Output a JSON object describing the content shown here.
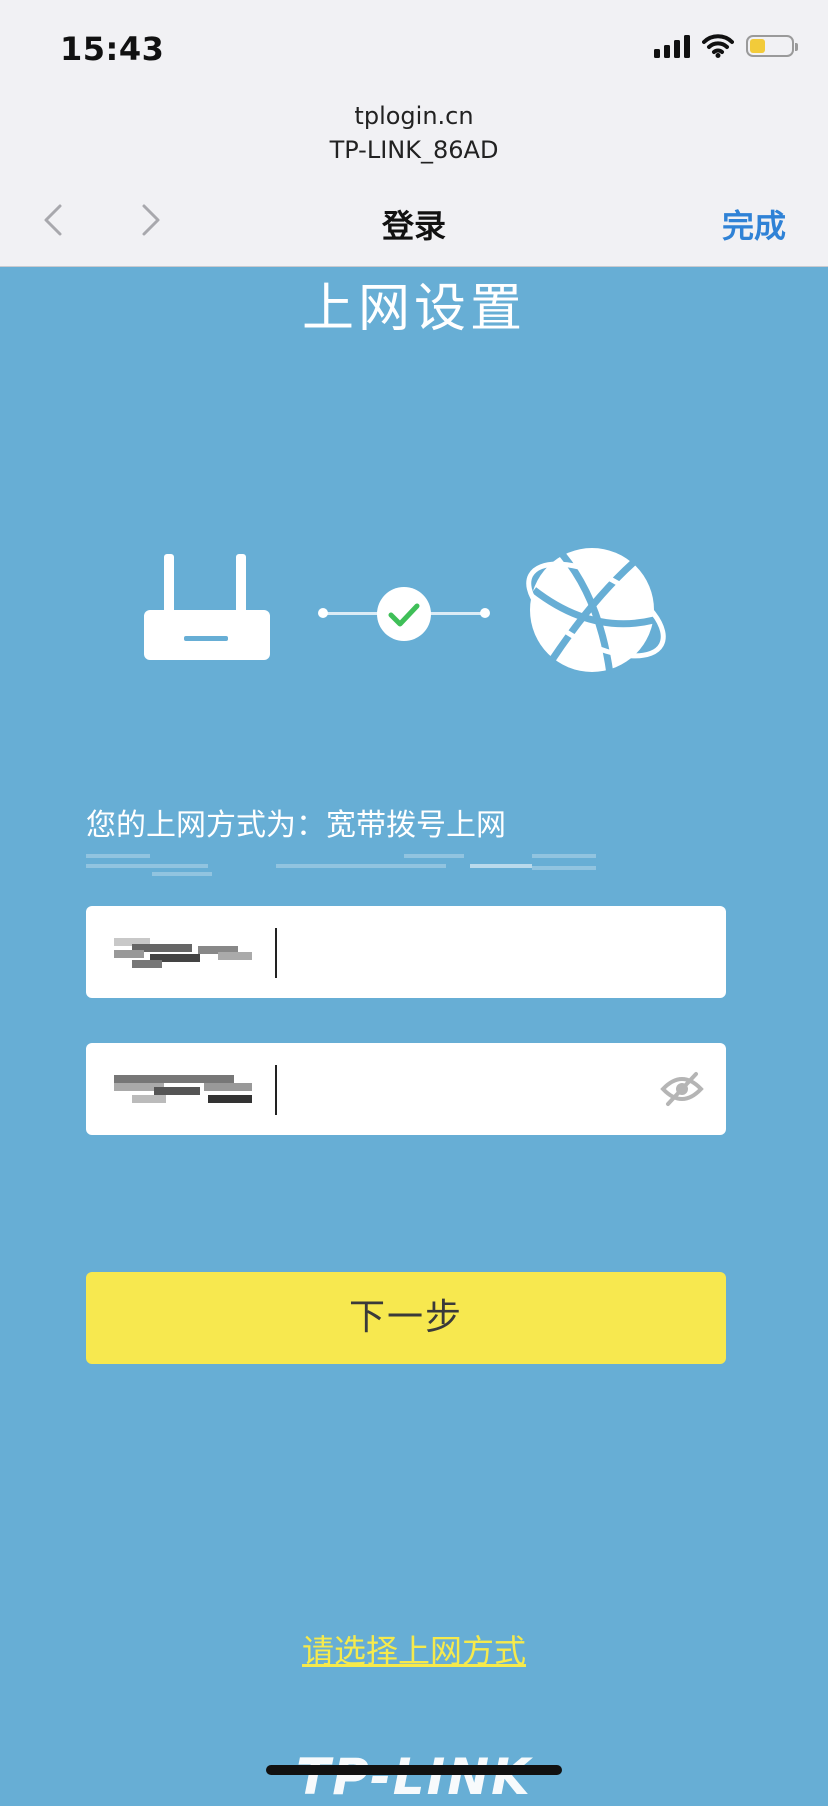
{
  "status_bar": {
    "time": "15:43",
    "battery_level": 0.38,
    "battery_color": "#f2cb3a"
  },
  "browser": {
    "domain": "tplogin.cn",
    "network_name": "TP-LINK_86AD",
    "title": "登录",
    "done_label": "完成",
    "done_color": "#2f82d6"
  },
  "page": {
    "title": "上网设置",
    "mode_text": "您的上网方式为：宽带拨号上网",
    "next_label": "下一步",
    "select_mode_link": "请选择上网方式",
    "brand": "TP-LINK",
    "background_color": "#67aed5",
    "button_color": "#f7e84f",
    "link_color": "#f6ea4c"
  },
  "form": {
    "username_value": "",
    "password_value": ""
  },
  "icons": {
    "router": "router-icon",
    "status": "check-icon",
    "internet": "globe-icon",
    "visibility": "eye-off-icon"
  }
}
